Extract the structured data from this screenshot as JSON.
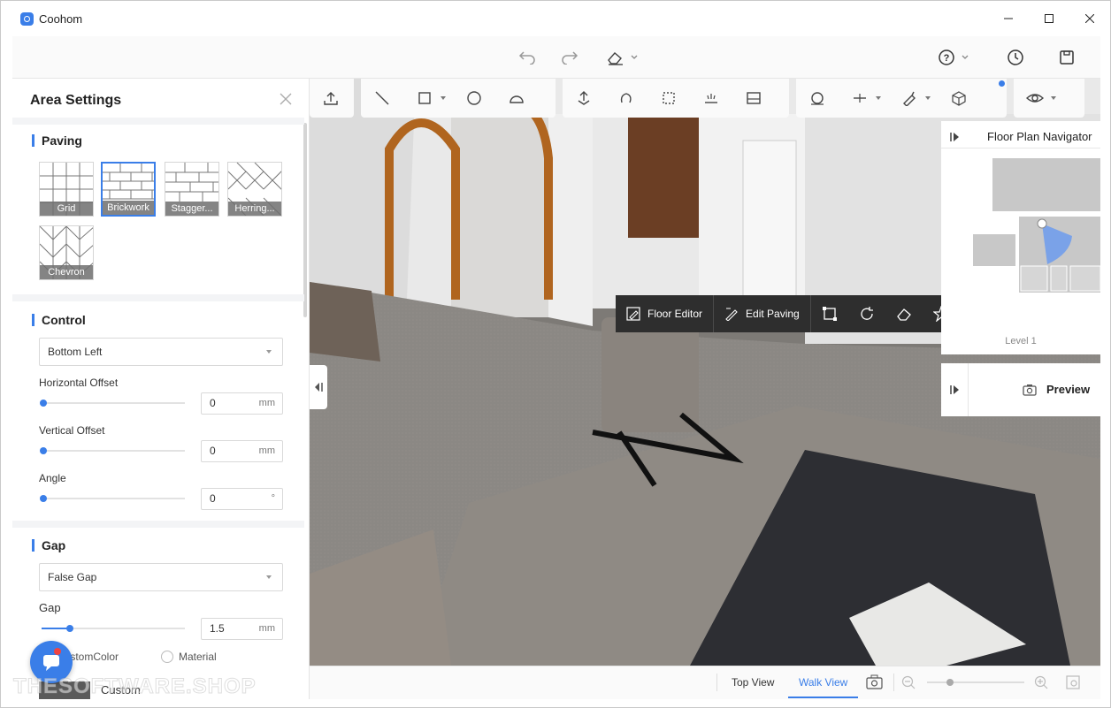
{
  "window": {
    "title": "Coohom"
  },
  "icons": {
    "undo": "undo-icon",
    "redo": "redo-icon",
    "eraser": "eraser-icon",
    "help": "help-icon",
    "history": "clock-icon",
    "save": "save-icon"
  },
  "panel": {
    "title": "Area Settings",
    "paving": {
      "title": "Paving",
      "patterns": [
        "Grid",
        "Brickwork",
        "Stagger...",
        "Herring...",
        "Chevron"
      ],
      "selected": "Brickwork"
    },
    "control": {
      "title": "Control",
      "anchor": "Bottom Left",
      "horizontal_offset_label": "Horizontal Offset",
      "horizontal_offset": "0",
      "horizontal_unit": "mm",
      "vertical_offset_label": "Vertical Offset",
      "vertical_offset": "0",
      "vertical_unit": "mm",
      "angle_label": "Angle",
      "angle": "0",
      "angle_unit": "°"
    },
    "gap": {
      "title": "Gap",
      "type": "False Gap",
      "gap_label": "Gap",
      "gap_value": "1.5",
      "gap_unit": "mm",
      "gap_fraction": 0.2,
      "option_custom": "CustomColor",
      "option_material": "Material",
      "custom_label": "Custom"
    }
  },
  "floating_bar": {
    "floor_editor": "Floor Editor",
    "edit_paving": "Edit Paving"
  },
  "navigator": {
    "title": "Floor Plan Navigator",
    "level": "Level 1"
  },
  "preview": {
    "label": "Preview"
  },
  "bottom": {
    "top_view": "Top View",
    "walk_view": "Walk View"
  },
  "watermark": "THESOFTWARE.SHOP",
  "colors": {
    "accent": "#3a7ee8",
    "floating_bar": "#2e2e2e",
    "badge": "#f04343"
  }
}
